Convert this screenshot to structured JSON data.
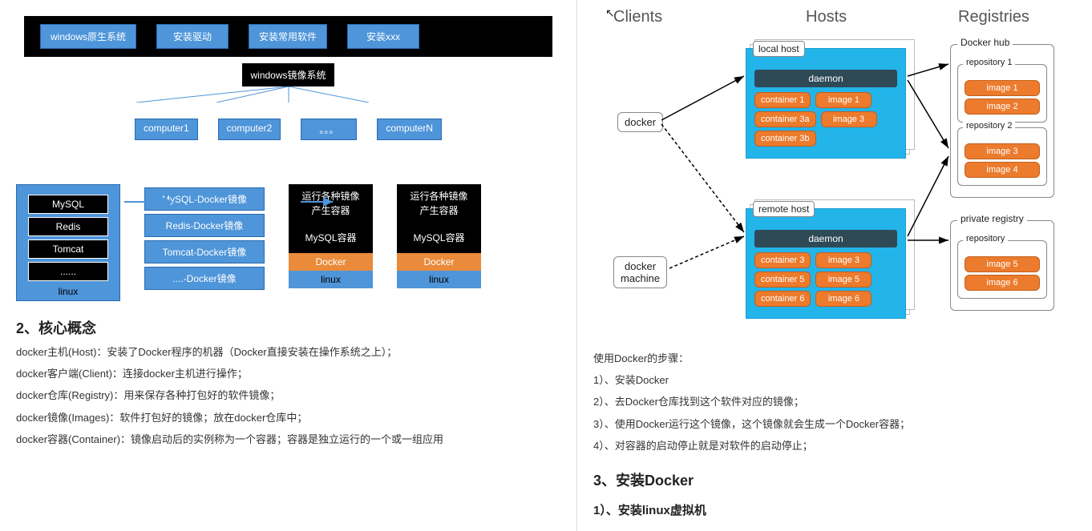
{
  "diagram1": {
    "topbar": [
      "windows原生系统",
      "安装驱动",
      "安装常用软件",
      "安装xxx"
    ],
    "mirror": "windows镜像系统",
    "computers": [
      "computer1",
      "computer2",
      "。。。",
      "computerN"
    ]
  },
  "diagram2": {
    "host_stack": [
      "MySQL",
      "Redis",
      "Tomcat",
      "......"
    ],
    "host_label": "linux",
    "images": [
      "MySQL-Docker镜像",
      "Redis-Docker镜像",
      "Tomcat-Docker镜像",
      "....-Docker镜像"
    ],
    "run_top": "运行各种镜像\n产生容器",
    "run_container": "MySQL容器",
    "run_docker": "Docker",
    "run_os": "linux"
  },
  "section2": {
    "heading": "2、核心概念",
    "lines": [
      "docker主机(Host)：安装了Docker程序的机器（Docker直接安装在操作系统之上）；",
      "docker客户端(Client)：连接docker主机进行操作；",
      "docker仓库(Registry)：用来保存各种打包好的软件镜像；",
      "docker镜像(Images)：软件打包好的镜像；放在docker仓库中；",
      "docker容器(Container)：镜像启动后的实例称为一个容器；容器是独立运行的一个或一组应用"
    ]
  },
  "arch": {
    "headers": {
      "clients": "Clients",
      "hosts": "Hosts",
      "registries": "Registries"
    },
    "clients": {
      "docker": "docker",
      "machine": "docker\nmachine"
    },
    "local_host": {
      "label": "local host",
      "daemon": "daemon",
      "rows": [
        [
          "container 1",
          "image 1"
        ],
        [
          "container 3a",
          "image 3"
        ],
        [
          "container 3b",
          ""
        ]
      ]
    },
    "remote_host": {
      "label": "remote host",
      "daemon": "daemon",
      "rows": [
        [
          "container 3",
          "image 3"
        ],
        [
          "container 5",
          "image 5"
        ],
        [
          "container 6",
          "image 6"
        ]
      ]
    },
    "docker_hub": {
      "label": "Docker hub",
      "repos": [
        {
          "label": "repository 1",
          "images": [
            "image 1",
            "image 2"
          ]
        },
        {
          "label": "repository 2",
          "images": [
            "image 3",
            "image 4"
          ]
        }
      ]
    },
    "private_registry": {
      "label": "private registry",
      "repos": [
        {
          "label": "repository",
          "images": [
            "image 5",
            "image 6"
          ]
        }
      ]
    }
  },
  "right_text": {
    "intro": "使用Docker的步骤：",
    "steps": [
      "1）、安装Docker",
      "2）、去Docker仓库找到这个软件对应的镜像；",
      "3）、使用Docker运行这个镜像，这个镜像就会生成一个Docker容器；",
      "4）、对容器的启动停止就是对软件的启动停止；"
    ],
    "heading3": "3、安装Docker",
    "sub1": "1）、安装linux虚拟机"
  }
}
